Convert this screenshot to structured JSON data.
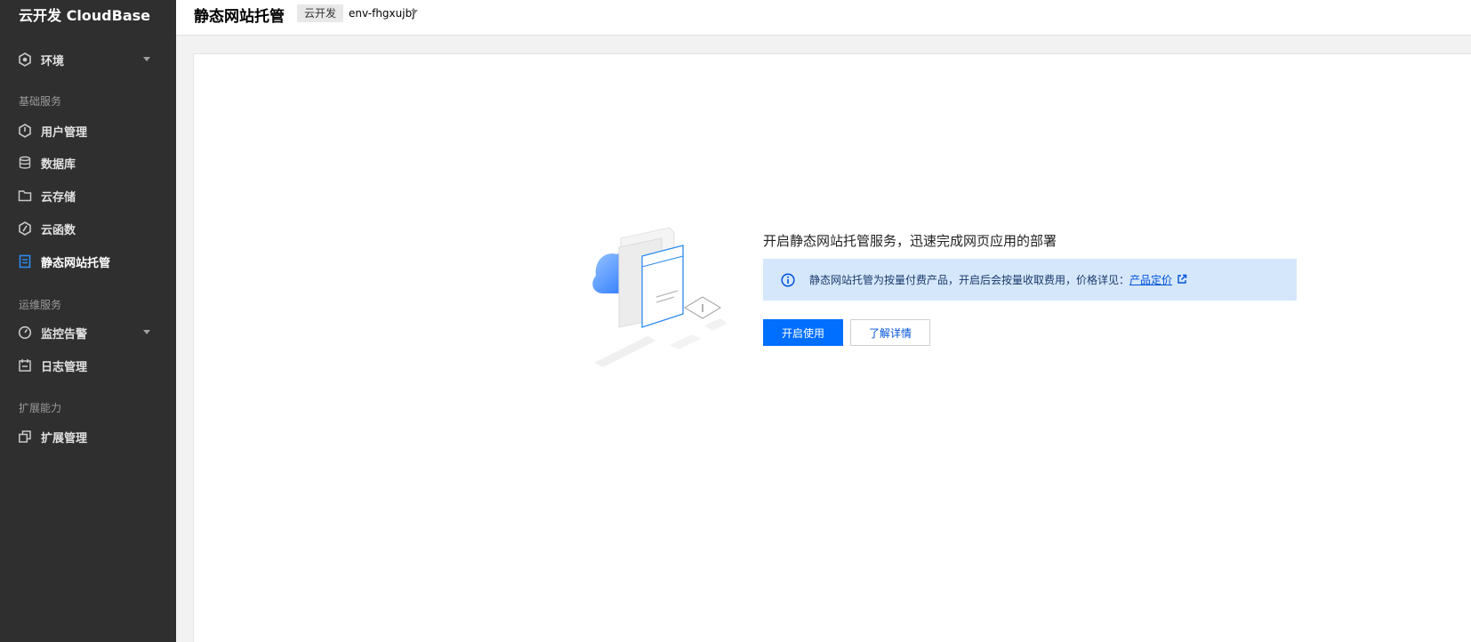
{
  "sidebar": {
    "brand": "云开发 CloudBase",
    "env_item": {
      "label": "环境",
      "icon": "env-hexagon-icon"
    },
    "groups": [
      {
        "title": "基础服务"
      },
      {
        "title": "运维服务"
      },
      {
        "title": "扩展能力"
      }
    ],
    "items": [
      {
        "label": "用户管理",
        "icon": "user-management-icon"
      },
      {
        "label": "数据库",
        "icon": "database-icon"
      },
      {
        "label": "云存储",
        "icon": "folder-icon"
      },
      {
        "label": "云函数",
        "icon": "function-icon"
      },
      {
        "label": "静态网站托管",
        "icon": "static-hosting-icon",
        "active": true
      },
      {
        "label": "监控告警",
        "icon": "monitor-icon",
        "expandable": true
      },
      {
        "label": "日志管理",
        "icon": "log-icon"
      },
      {
        "label": "扩展管理",
        "icon": "extension-icon"
      }
    ],
    "colors": {
      "background": "#2f2f2f",
      "active_icon": "#2d8cf0"
    }
  },
  "header": {
    "title": "静态网站托管",
    "env_tag": "云开发",
    "env_name": "env-fhgxujbj"
  },
  "main": {
    "headline": "开启静态网站托管服务，迅速完成网页应用的部署",
    "notice": {
      "text": "静态网站托管为按量付费产品，开启后会按量收取费用，价格详见：",
      "link": "产品定价",
      "background": "#d5e7fb"
    },
    "primary_button": "开启使用",
    "secondary_button": "了解详情",
    "accent": "#006eff"
  }
}
